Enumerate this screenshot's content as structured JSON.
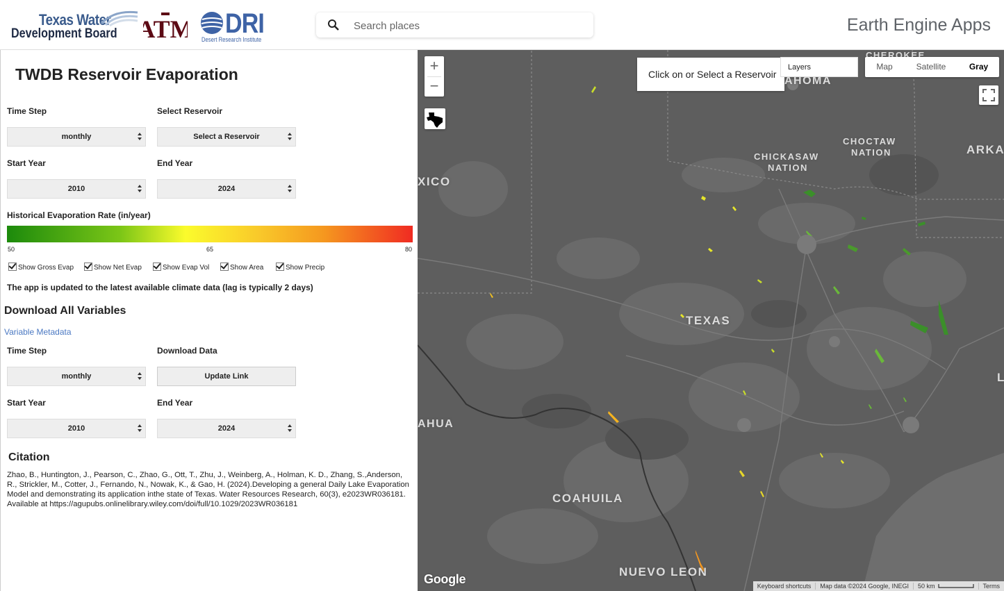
{
  "header": {
    "logo_twdb_line1": "Texas Water",
    "logo_twdb_line2": "Development Board",
    "logo_atm": "ATM",
    "logo_dri": "DRI",
    "logo_dri_sub": "Desert Research Institute",
    "search_placeholder": "Search places",
    "app_title": "Earth Engine Apps"
  },
  "panel": {
    "title": "TWDB Reservoir Evaporation",
    "time_step_label": "Time Step",
    "time_step_value": "monthly",
    "reservoir_label": "Select Reservoir",
    "reservoir_value": "Select a Reservoir",
    "start_year_label": "Start Year",
    "start_year_value": "2010",
    "end_year_label": "End Year",
    "end_year_value": "2024",
    "legend_label": "Historical Evaporation Rate (in/year)",
    "legend_min": "50",
    "legend_mid": "65",
    "legend_max": "80",
    "legend_colors": [
      "#1c8a0c",
      "#7cc617",
      "#fbfb2c",
      "#f9c92a",
      "#f5981f",
      "#f02b22"
    ],
    "checkboxes": [
      {
        "label": "Show Gross Evap",
        "checked": true
      },
      {
        "label": "Show Net Evap",
        "checked": true
      },
      {
        "label": "Show Evap Vol",
        "checked": true
      },
      {
        "label": "Show Area",
        "checked": true
      },
      {
        "label": "Show Precip",
        "checked": true
      }
    ],
    "update_note": "The app is updated to the latest available climate data (lag is typically 2 days)",
    "download_title": "Download All Variables",
    "metadata_link": "Variable Metadata",
    "dl_time_step_label": "Time Step",
    "dl_time_step_value": "monthly",
    "dl_data_label": "Download Data",
    "dl_update_button": "Update Link",
    "dl_start_year_label": "Start Year",
    "dl_start_year_value": "2010",
    "dl_end_year_label": "End Year",
    "dl_end_year_value": "2024",
    "citation_title": "Citation",
    "citation_text": "Zhao, B., Huntington, J., Pearson, C., Zhao, G., Ott, T., Zhu, J., Weinberg, A., Holman, K. D., Zhang, S.,Anderson, R., Strickler, M., Cotter, J., Fernando, N., Nowak, K., & Gao, H. (2024).Developing a general Daily Lake Evaporation Model and demonstrating its application inthe state of Texas. Water Resources Research, 60(3), e2023WR036181. Available at https://agupubs.onlinelibrary.wiley.com/doi/full/10.1029/2023WR036181"
  },
  "map": {
    "zoom_in": "+",
    "zoom_out": "−",
    "info_text": "Click on or Select a Reservoir",
    "layers_label": "Layers",
    "map_types": [
      {
        "label": "Map",
        "active": false
      },
      {
        "label": "Satellite",
        "active": false
      },
      {
        "label": "Gray",
        "active": true
      }
    ],
    "places": {
      "cherokee": "CHEROKEE",
      "oklahoma": "AHOMA",
      "chickasaw1": "CHICKASAW",
      "chickasaw2": "NATION",
      "choctaw1": "CHOCTAW",
      "choctaw2": "NATION",
      "arkansas": "ARKA",
      "mexico": "XICO",
      "texas": "TEXAS",
      "chihuahua": "AHUA",
      "coahuila": "COAHUILA",
      "nuevo_leon": "NUEVO LEON",
      "louisiana": "L"
    },
    "google_logo": "Google",
    "attribution": {
      "shortcuts": "Keyboard shortcuts",
      "map_data": "Map data ©2024 Google, INEGI",
      "scale": "50 km",
      "terms": "Terms"
    }
  }
}
